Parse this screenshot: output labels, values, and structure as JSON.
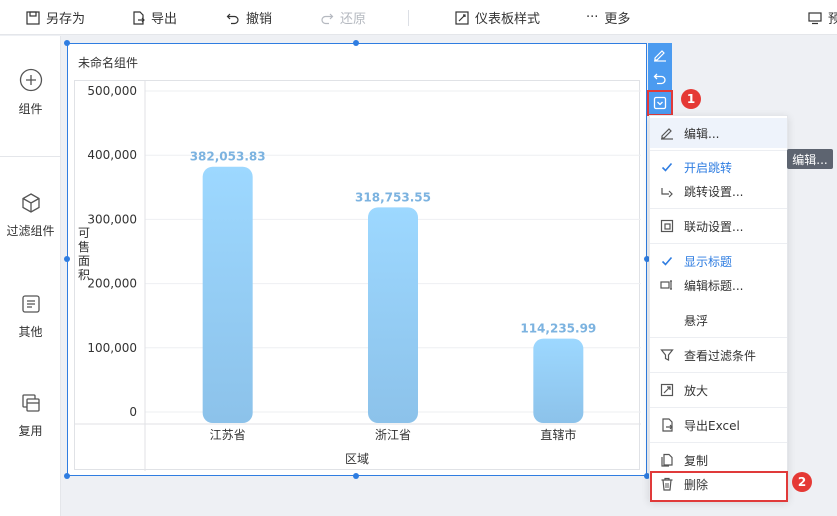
{
  "toolbar": {
    "save_as": "另存为",
    "export": "导出",
    "undo": "撤销",
    "redo": "还原",
    "dashboard_style": "仪表板样式",
    "more": "更多",
    "preview": "预"
  },
  "left_panel": {
    "components": "组件",
    "filter_components": "过滤组件",
    "other": "其他",
    "reuse": "复用"
  },
  "widget": {
    "title": "未命名组件"
  },
  "chart_data": {
    "type": "bar",
    "categories": [
      "江苏省",
      "浙江省",
      "直辖市"
    ],
    "values": [
      382053.83,
      318753.55,
      114235.99
    ],
    "value_labels": [
      "382,053.83",
      "318,753.55",
      "114,235.99"
    ],
    "xlabel": "区域",
    "ylabel": "可售面积",
    "ylim": [
      0,
      500000
    ],
    "yticks": [
      0,
      100000,
      200000,
      300000,
      400000,
      500000
    ],
    "ytick_labels": [
      "0",
      "100,000",
      "200,000",
      "300,000",
      "400,000",
      "500,000"
    ],
    "grid": true,
    "bar_gradient": [
      "#9dd8ff",
      "#8cc2ea"
    ],
    "label_color": "#7cb3e0"
  },
  "badges": {
    "first": "1",
    "second": "2"
  },
  "menu": {
    "edit": "编辑...",
    "enable_jump": "开启跳转",
    "jump_settings": "跳转设置...",
    "linkage_settings": "联动设置...",
    "show_title": "显示标题",
    "edit_title": "编辑标题...",
    "float": "悬浮",
    "view_filter": "查看过滤条件",
    "enlarge": "放大",
    "export_excel": "导出Excel",
    "copy": "复制",
    "delete": "删除"
  },
  "tooltip": {
    "text": "编辑..."
  },
  "colors": {
    "accent": "#2f7de1",
    "highlight": "#e03a3a",
    "action_bar": "#4b9bf0"
  }
}
